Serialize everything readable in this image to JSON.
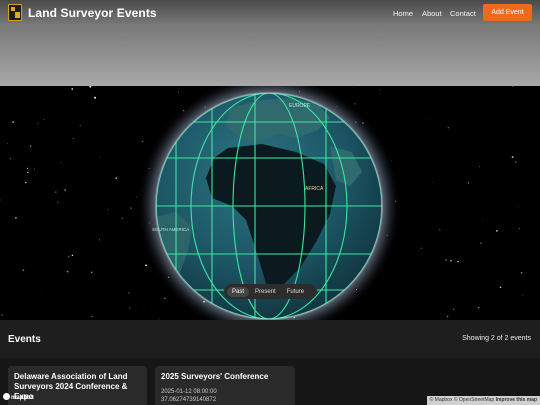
{
  "header": {
    "brand": "Land Surveyor Events",
    "nav": [
      "Home",
      "About",
      "Contact"
    ],
    "add_event": "Add Event"
  },
  "map": {
    "labels": {
      "europe": "EUROPE",
      "africa": "AFRICA",
      "south_america": "SOUTH AMERICA"
    },
    "time_toggle": [
      "Past",
      "Present",
      "Future"
    ],
    "selected": "Past"
  },
  "events": {
    "title": "Events",
    "count_text": "Showing 2 of 2 events",
    "cards": [
      {
        "title": "Delaware Association of Land Surveyors 2024 Conference & Expo",
        "meta": ""
      },
      {
        "title": "2025 Surveyors' Conference",
        "meta": "2025-01-12 08:00:00",
        "coord": "37.06274739140872"
      }
    ]
  },
  "footer": {
    "logo_text": "mapbox",
    "attribution": "© Mapbox © OpenStreetMap",
    "improve": "Improve this map"
  },
  "colors": {
    "accent": "#f06a1d",
    "grid": "#3ee6a0",
    "ocean": "#1e5a6a"
  }
}
